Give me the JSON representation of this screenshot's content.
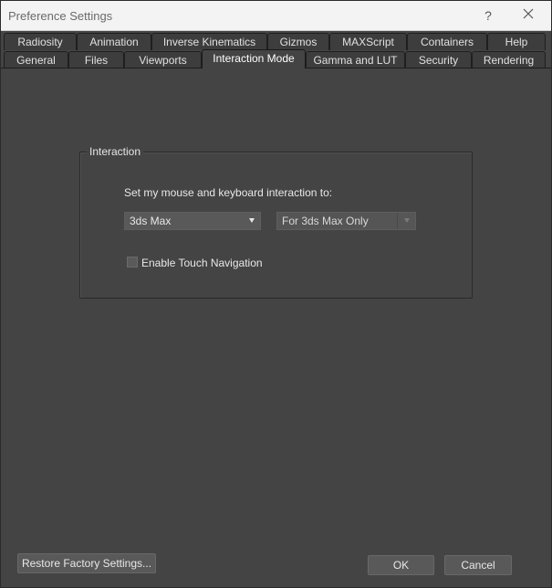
{
  "window": {
    "title": "Preference Settings",
    "help_symbol": "?",
    "close_icon": "close-icon"
  },
  "tabs": {
    "row1": [
      "Radiosity",
      "Animation",
      "Inverse Kinematics",
      "Gizmos",
      "MAXScript",
      "Containers",
      "Help"
    ],
    "row2": [
      "General",
      "Files",
      "Viewports",
      "Interaction Mode",
      "Gamma and LUT",
      "Security",
      "Rendering"
    ],
    "active": "Interaction Mode"
  },
  "interaction": {
    "group_title": "Interaction",
    "prompt": "Set my mouse and keyboard interaction to:",
    "mode_select": {
      "value": "3ds Max"
    },
    "scope_select": {
      "value": "For 3ds Max Only",
      "disabled": true
    },
    "touch_nav": {
      "label": "Enable Touch Navigation",
      "checked": false
    }
  },
  "footer": {
    "restore_label": "Restore Factory Settings...",
    "ok_label": "OK",
    "cancel_label": "Cancel"
  },
  "colors": {
    "background": "#444444",
    "titlebar": "#f3f3f3",
    "control": "#595959",
    "text": "#e8e8e8"
  }
}
